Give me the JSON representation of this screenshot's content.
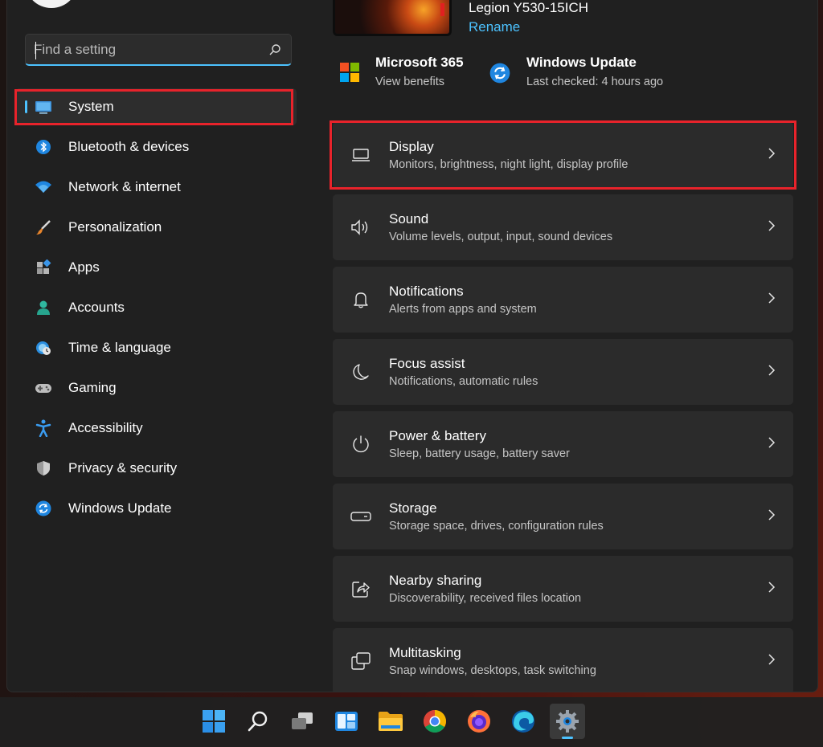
{
  "sidebar": {
    "search": {
      "placeholder": "Find a setting",
      "value": ""
    },
    "items": [
      {
        "label": "System",
        "active": true,
        "icon": "monitor-icon"
      },
      {
        "label": "Bluetooth & devices",
        "icon": "bluetooth-icon"
      },
      {
        "label": "Network & internet",
        "icon": "wifi-icon"
      },
      {
        "label": "Personalization",
        "icon": "brush-icon"
      },
      {
        "label": "Apps",
        "icon": "apps-icon"
      },
      {
        "label": "Accounts",
        "icon": "person-icon"
      },
      {
        "label": "Time & language",
        "icon": "globe-clock-icon"
      },
      {
        "label": "Gaming",
        "icon": "gamepad-icon"
      },
      {
        "label": "Accessibility",
        "icon": "accessibility-icon"
      },
      {
        "label": "Privacy & security",
        "icon": "shield-icon"
      },
      {
        "label": "Windows Update",
        "icon": "sync-icon"
      }
    ]
  },
  "device": {
    "name": "Legion Y530-15ICH",
    "rename": "Rename"
  },
  "quick": {
    "m365": {
      "title": "Microsoft 365",
      "subtitle": "View benefits"
    },
    "update": {
      "title": "Windows Update",
      "subtitle": "Last checked: 4 hours ago"
    }
  },
  "cards": [
    {
      "title": "Display",
      "subtitle": "Monitors, brightness, night light, display profile",
      "icon": "laptop-icon"
    },
    {
      "title": "Sound",
      "subtitle": "Volume levels, output, input, sound devices",
      "icon": "speaker-icon"
    },
    {
      "title": "Notifications",
      "subtitle": "Alerts from apps and system",
      "icon": "bell-icon"
    },
    {
      "title": "Focus assist",
      "subtitle": "Notifications, automatic rules",
      "icon": "moon-icon"
    },
    {
      "title": "Power & battery",
      "subtitle": "Sleep, battery usage, battery saver",
      "icon": "power-icon"
    },
    {
      "title": "Storage",
      "subtitle": "Storage space, drives, configuration rules",
      "icon": "storage-icon"
    },
    {
      "title": "Nearby sharing",
      "subtitle": "Discoverability, received files location",
      "icon": "share-icon"
    },
    {
      "title": "Multitasking",
      "subtitle": "Snap windows, desktops, task switching",
      "icon": "multitask-icon"
    }
  ],
  "taskbar": [
    "start-icon",
    "search-icon",
    "task-view-icon",
    "widgets-icon",
    "file-explorer-icon",
    "chrome-icon",
    "firefox-icon",
    "edge-icon",
    "settings-icon"
  ],
  "colors": {
    "accent": "#4cc2ff",
    "highlight": "#e8232b",
    "window": "#202020",
    "card": "#2b2b2b"
  }
}
